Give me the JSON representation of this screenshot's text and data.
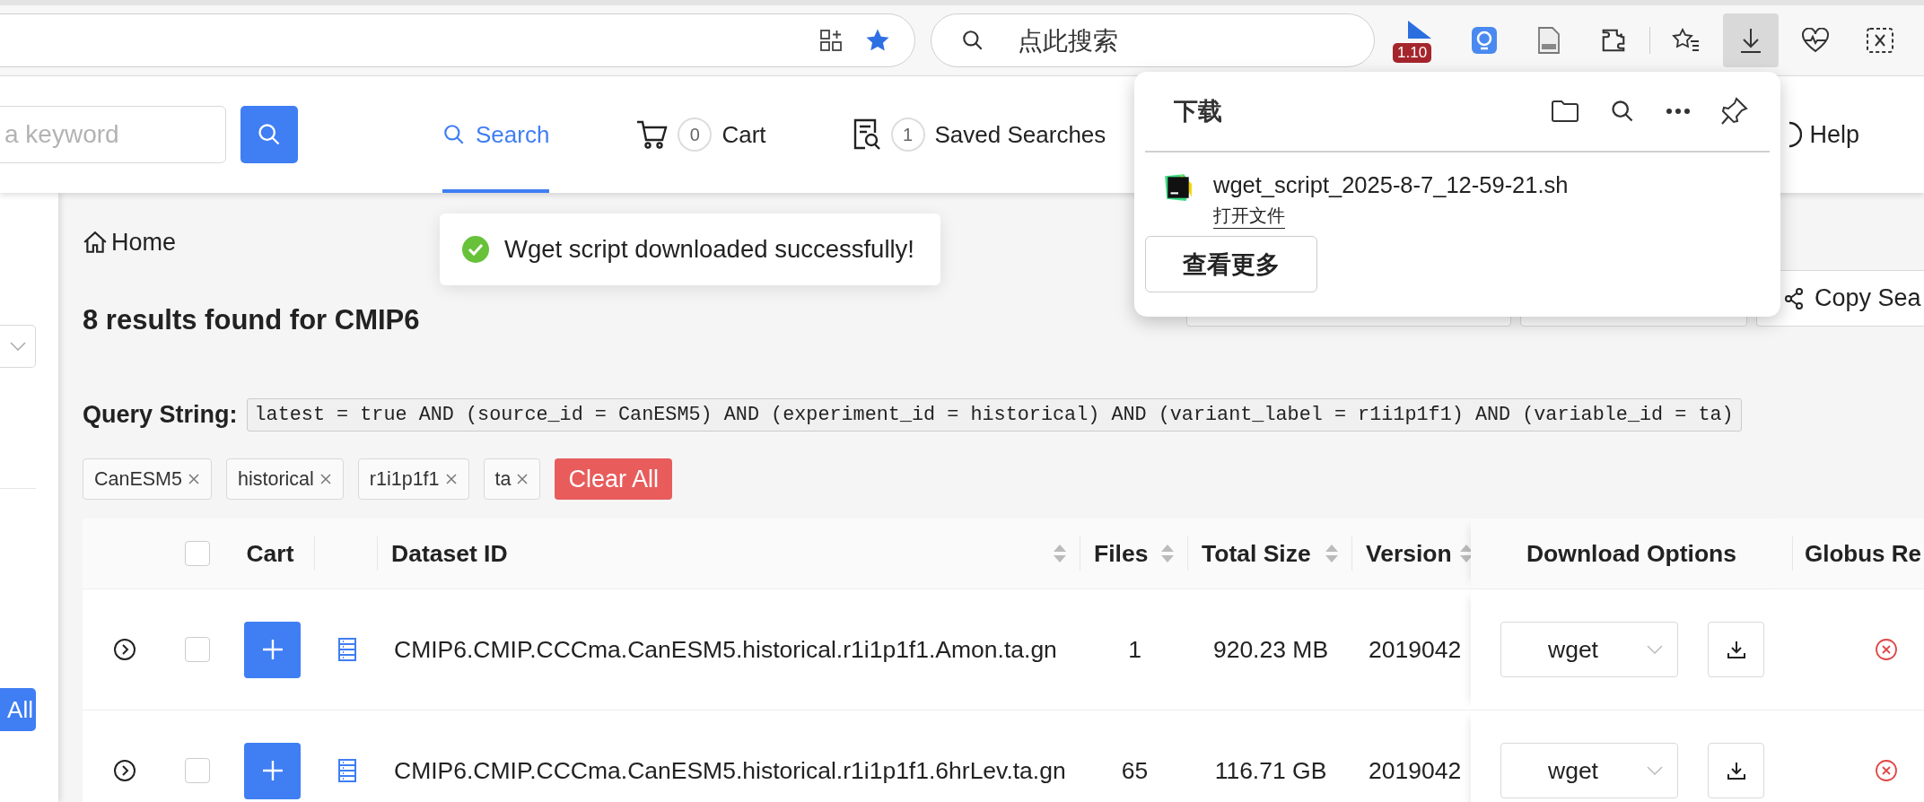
{
  "browser": {
    "search_placeholder": "点此搜索",
    "extension_badge": "1.10"
  },
  "header": {
    "keyword_placeholder": "a keyword",
    "nav": [
      {
        "kind": "search",
        "label": "Search",
        "selected": true
      },
      {
        "kind": "cart",
        "label": "Cart",
        "count": "0",
        "selected": false
      },
      {
        "kind": "saved",
        "label": "Saved Searches",
        "count": "1",
        "selected": false
      }
    ],
    "help": "Help"
  },
  "sidebar": {
    "button": "All"
  },
  "breadcrumb": "Home",
  "toast": "Wget script downloaded successfully!",
  "results_title": "8 results found for CMIP6",
  "copy_button": "Copy Sea",
  "query": {
    "label": "Query String:",
    "value": "latest = true AND (source_id = CanESM5) AND (experiment_id = historical) AND (variant_label = r1i1p1f1) AND (variable_id = ta)"
  },
  "filters": [
    "CanESM5",
    "historical",
    "r1i1p1f1",
    "ta"
  ],
  "clear_all": "Clear All",
  "table": {
    "columns": [
      {
        "label": "Cart",
        "sortable": false
      },
      {
        "label": "Dataset ID",
        "sortable": true
      },
      {
        "label": "Files",
        "sortable": true
      },
      {
        "label": "Total Size",
        "sortable": true
      },
      {
        "label": "Version",
        "sortable": true
      },
      {
        "label": "Download Options",
        "sortable": false
      },
      {
        "label": "Globus Re",
        "sortable": false
      }
    ],
    "all_checked": false,
    "rows": [
      {
        "checked": false,
        "dataset_id": "CMIP6.CMIP.CCCma.CanESM5.historical.r1i1p1f1.Amon.ta.gn",
        "files": "1",
        "total_size": "920.23 MB",
        "version": "2019042",
        "download": "wget"
      },
      {
        "checked": false,
        "dataset_id": "CMIP6.CMIP.CCCma.CanESM5.historical.r1i1p1f1.6hrLev.ta.gn",
        "files": "65",
        "total_size": "116.71 GB",
        "version": "2019042",
        "download": "wget"
      }
    ]
  },
  "downloads": {
    "title": "下载",
    "file": "wget_script_2025-8-7_12-59-21.sh",
    "open_link": "打开文件",
    "more_button": "查看更多"
  }
}
